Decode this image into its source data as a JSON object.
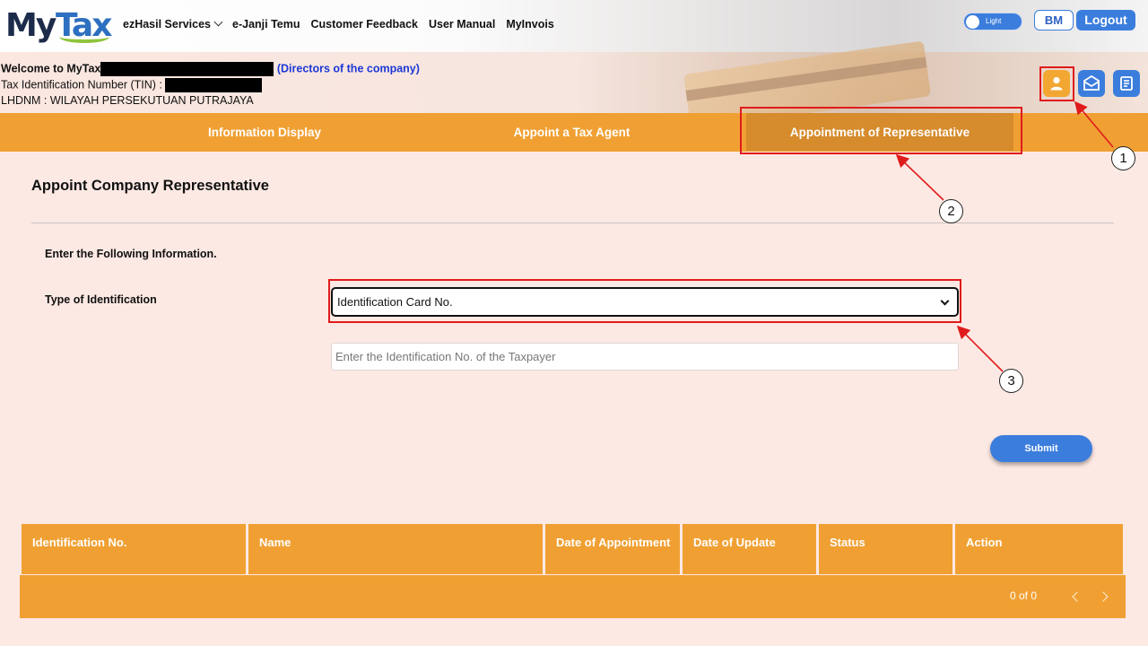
{
  "header": {
    "logo_part1": "My",
    "logo_part2": "Tax",
    "nav": [
      "ezHasil Services",
      "e-Janji Temu",
      "Customer Feedback",
      "User Manual",
      "MyInvois"
    ],
    "theme_toggle_label": "Light",
    "language_button": "BM",
    "logout_button": "Logout"
  },
  "welcome": {
    "line1_prefix": "Welcome to MyTax",
    "line1_role": "(Directors of the company)",
    "line2": "Tax Identification Number (TIN) :",
    "line3": "LHDNM : WILAYAH PERSEKUTUAN PUTRAJAYA",
    "icons": [
      "user-icon",
      "mail-icon",
      "document-icon"
    ]
  },
  "tabs": [
    {
      "label": "Information Display"
    },
    {
      "label": "Appoint a Tax Agent"
    },
    {
      "label": "Appointment of Representative",
      "active": true
    }
  ],
  "form": {
    "title": "Appoint Company Representative",
    "instruction": "Enter the Following Information.",
    "type_label": "Type of Identification",
    "type_selected": "Identification Card No.",
    "id_placeholder": "Enter the Identification No. of the Taxpayer",
    "submit": "Submit"
  },
  "table": {
    "columns": [
      "Identification No.",
      "Name",
      "Date of Appointment",
      "Date of Update",
      "Status",
      "Action"
    ],
    "rows": [],
    "pagination": "0 of 0"
  },
  "annotations": [
    "1",
    "2",
    "3"
  ],
  "colors": {
    "orange": "#f0a033",
    "active_tab": "#d68b2c",
    "blue": "#3b7ddd",
    "highlight_red": "#e01b1b",
    "background": "#fde9e4"
  }
}
